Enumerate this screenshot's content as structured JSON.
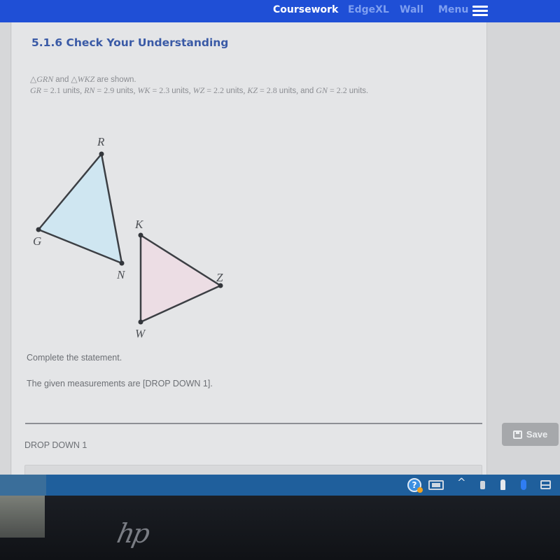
{
  "nav": {
    "items": [
      {
        "label": "Coursework",
        "active": true
      },
      {
        "label": "EdgeXL",
        "active": false
      },
      {
        "label": "Wall",
        "active": false
      },
      {
        "label": "Menu",
        "active": false
      }
    ],
    "menu_icon": "hamburger-icon",
    "brand_color": "#1f4fd6"
  },
  "page": {
    "title": "5.1.6 Check Your Understanding"
  },
  "problem": {
    "triangle_1": "GRN",
    "triangle_2": "WKZ",
    "triangle_symbol": "△",
    "and": "and",
    "are_shown": "are shown.",
    "units_word": "units",
    "measurements": [
      {
        "segment": "GR",
        "value": "2.1"
      },
      {
        "segment": "RN",
        "value": "2.9"
      },
      {
        "segment": "WK",
        "value": "2.3"
      },
      {
        "segment": "WZ",
        "value": "2.2"
      },
      {
        "segment": "KZ",
        "value": "2.8"
      },
      {
        "segment": "GN",
        "value": "2.2"
      }
    ],
    "final_conjunction": "and"
  },
  "figure": {
    "triangle_grn": {
      "vertices": [
        "G",
        "R",
        "N"
      ],
      "fill": "#cfe6f1"
    },
    "triangle_wkz": {
      "vertices": [
        "W",
        "K",
        "Z"
      ],
      "fill": "#ecdde4"
    },
    "labels": {
      "G": "G",
      "R": "R",
      "N": "N",
      "K": "K",
      "Z": "Z",
      "W": "W"
    }
  },
  "question": {
    "instruction": "Complete the statement.",
    "statement": "The given measurements are [DROP DOWN 1].",
    "dropdown_label": "DROP DOWN 1",
    "dropdown_value": ""
  },
  "actions": {
    "save_label": "Save",
    "save_icon": "save-icon"
  },
  "taskbar": {
    "tray_icons": [
      "help-icon",
      "battery-icon",
      "chevron-up-icon",
      "usb-icon",
      "microphone-icon",
      "bluetooth-icon",
      "display-icon"
    ],
    "chevron_glyph": "^"
  },
  "device": {
    "logo": "hp"
  }
}
